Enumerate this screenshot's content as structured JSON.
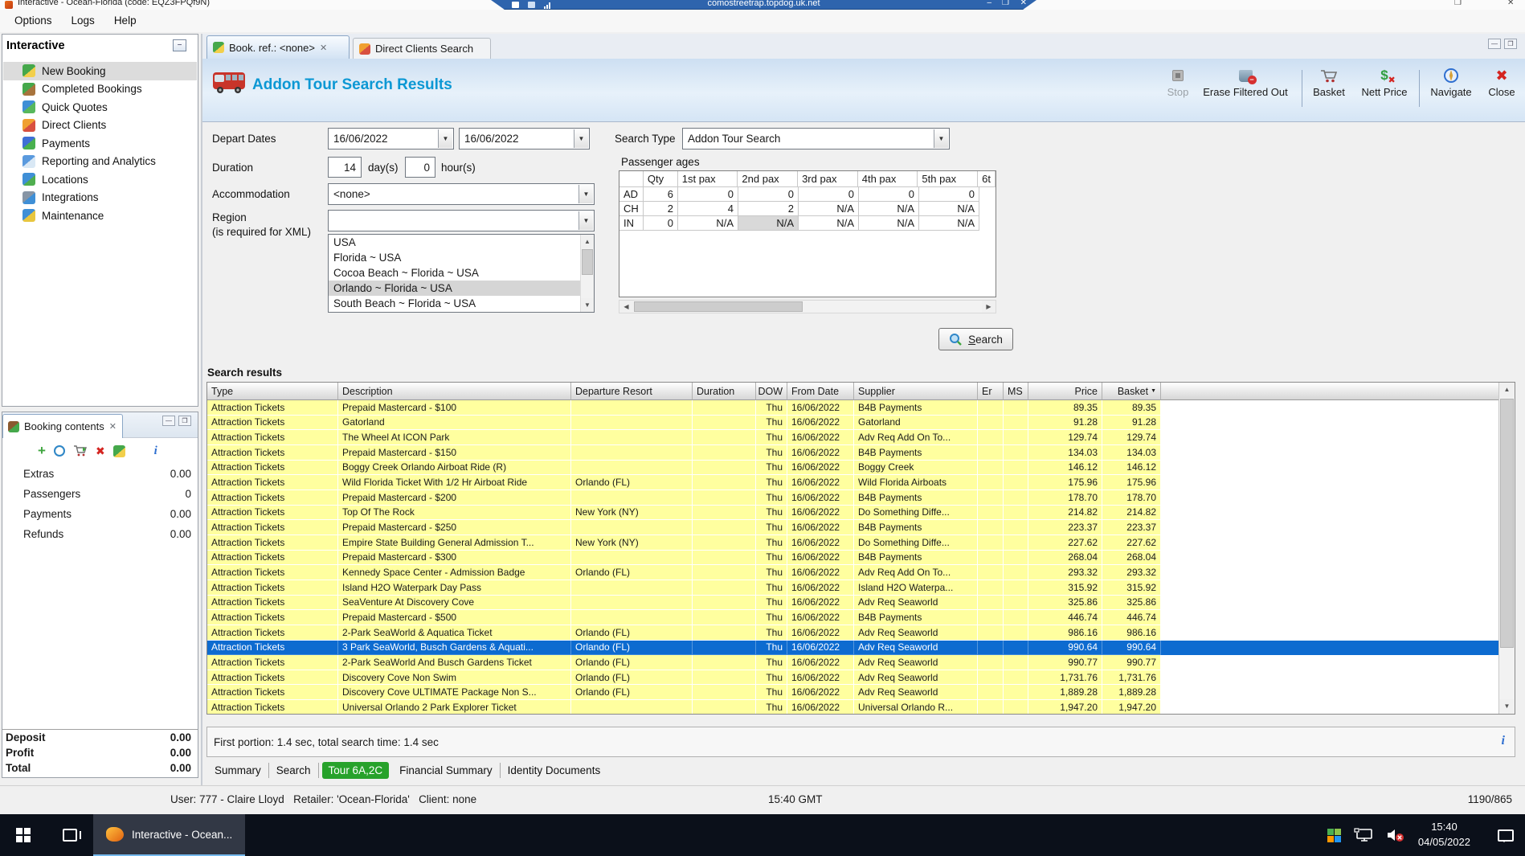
{
  "window": {
    "title": "Interactive - Ocean-Florida (code: EQZ3FPQf9N)",
    "menu": [
      "Options",
      "Logs",
      "Help"
    ],
    "rdp_address": "comostreetrap.topdog.uk.net"
  },
  "sidebar": {
    "title": "Interactive",
    "items": [
      {
        "label": "New Booking",
        "icon": "palm-tree-icon",
        "selected": true
      },
      {
        "label": "Completed Bookings",
        "icon": "completed-bookings-icon",
        "selected": false
      },
      {
        "label": "Quick Quotes",
        "icon": "quick-quotes-icon",
        "selected": false
      },
      {
        "label": "Direct Clients",
        "icon": "direct-clients-icon",
        "selected": false
      },
      {
        "label": "Payments",
        "icon": "payments-icon",
        "selected": false
      },
      {
        "label": "Reporting and Analytics",
        "icon": "reporting-icon",
        "selected": false
      },
      {
        "label": "Locations",
        "icon": "locations-icon",
        "selected": false
      },
      {
        "label": "Integrations",
        "icon": "integrations-icon",
        "selected": false
      },
      {
        "label": "Maintenance",
        "icon": "maintenance-icon",
        "selected": false
      }
    ]
  },
  "booking_contents": {
    "title": "Booking contents",
    "rows": [
      {
        "label": "Extras",
        "value": "0.00"
      },
      {
        "label": "Passengers",
        "value": "0"
      },
      {
        "label": "Payments",
        "value": "0.00"
      },
      {
        "label": "Refunds",
        "value": "0.00"
      }
    ],
    "totals": [
      {
        "label": "Deposit",
        "value": "0.00"
      },
      {
        "label": "Profit",
        "value": "0.00"
      },
      {
        "label": "Total",
        "value": "0.00"
      }
    ]
  },
  "tabs": {
    "book_ref": {
      "label": "Book. ref.: <none>"
    },
    "direct_clients": {
      "label": "Direct Clients Search"
    }
  },
  "header": {
    "title": "Addon Tour Search Results",
    "toolbar": [
      {
        "label": "Stop",
        "disabled": true
      },
      {
        "label": "Erase Filtered Out",
        "disabled": false
      },
      {
        "label": "Basket",
        "disabled": false
      },
      {
        "label": "Nett Price",
        "disabled": false
      },
      {
        "label": "Navigate",
        "disabled": false
      },
      {
        "label": "Close",
        "disabled": false
      }
    ]
  },
  "form": {
    "depart_dates": {
      "label": "Depart Dates",
      "from": "16/06/2022",
      "to": "16/06/2022"
    },
    "duration": {
      "label": "Duration",
      "days": "14",
      "days_unit": "day(s)",
      "hours": "0",
      "hours_unit": "hour(s)"
    },
    "accommodation": {
      "label": "Accommodation",
      "value": "<none>"
    },
    "region": {
      "label": "Region",
      "note": "(is required for XML)",
      "value": "",
      "options": [
        "USA",
        "Florida ~ USA",
        "Cocoa Beach ~ Florida ~ USA",
        "Orlando ~ Florida ~ USA",
        "South Beach ~ Florida ~ USA"
      ],
      "selected": "Orlando ~ Florida ~ USA"
    },
    "search_type": {
      "label": "Search Type",
      "value": "Addon Tour Search"
    },
    "search_button": "Search"
  },
  "passenger_ages": {
    "title": "Passenger ages",
    "columns": [
      "",
      "Qty",
      "1st pax",
      "2nd pax",
      "3rd pax",
      "4th pax",
      "5th pax",
      "6t"
    ],
    "rows": [
      {
        "label": "AD",
        "cells": [
          "6",
          "0",
          "0",
          "0",
          "0",
          "0"
        ]
      },
      {
        "label": "CH",
        "cells": [
          "2",
          "4",
          "2",
          "N/A",
          "N/A",
          "N/A"
        ]
      },
      {
        "label": "IN",
        "cells": [
          "0",
          "N/A",
          "N/A",
          "N/A",
          "N/A",
          "N/A"
        ]
      }
    ],
    "selected_cell": {
      "row": 2,
      "cell": 2
    }
  },
  "results": {
    "label": "Search results",
    "status": "First portion: 1.4 sec, total search time: 1.4 sec",
    "columns": [
      "Type",
      "Description",
      "Departure Resort",
      "Duration",
      "DOW",
      "From Date",
      "Supplier",
      "Er",
      "MS",
      "Price",
      "Basket"
    ],
    "sorted_column": "Basket",
    "selected_row": 16,
    "rows": [
      [
        "Attraction Tickets",
        "Prepaid Mastercard - $100",
        "",
        "",
        "Thu",
        "16/06/2022",
        "B4B Payments",
        "",
        "",
        "89.35",
        "89.35"
      ],
      [
        "Attraction Tickets",
        "Gatorland",
        "",
        "",
        "Thu",
        "16/06/2022",
        "Gatorland",
        "",
        "",
        "91.28",
        "91.28"
      ],
      [
        "Attraction Tickets",
        "The Wheel At ICON Park",
        "",
        "",
        "Thu",
        "16/06/2022",
        "Adv Req Add On To...",
        "",
        "",
        "129.74",
        "129.74"
      ],
      [
        "Attraction Tickets",
        "Prepaid Mastercard - $150",
        "",
        "",
        "Thu",
        "16/06/2022",
        "B4B Payments",
        "",
        "",
        "134.03",
        "134.03"
      ],
      [
        "Attraction Tickets",
        "Boggy Creek Orlando Airboat Ride (R)",
        "",
        "",
        "Thu",
        "16/06/2022",
        "Boggy Creek",
        "",
        "",
        "146.12",
        "146.12"
      ],
      [
        "Attraction Tickets",
        "Wild Florida Ticket With 1/2 Hr Airboat Ride",
        "Orlando (FL)",
        "",
        "Thu",
        "16/06/2022",
        "Wild Florida Airboats",
        "",
        "",
        "175.96",
        "175.96"
      ],
      [
        "Attraction Tickets",
        "Prepaid Mastercard - $200",
        "",
        "",
        "Thu",
        "16/06/2022",
        "B4B Payments",
        "",
        "",
        "178.70",
        "178.70"
      ],
      [
        "Attraction Tickets",
        "Top Of The Rock",
        "New York (NY)",
        "",
        "Thu",
        "16/06/2022",
        "Do Something Diffe...",
        "",
        "",
        "214.82",
        "214.82"
      ],
      [
        "Attraction Tickets",
        "Prepaid Mastercard - $250",
        "",
        "",
        "Thu",
        "16/06/2022",
        "B4B Payments",
        "",
        "",
        "223.37",
        "223.37"
      ],
      [
        "Attraction Tickets",
        "Empire State Building General Admission T...",
        "New York (NY)",
        "",
        "Thu",
        "16/06/2022",
        "Do Something Diffe...",
        "",
        "",
        "227.62",
        "227.62"
      ],
      [
        "Attraction Tickets",
        "Prepaid Mastercard - $300",
        "",
        "",
        "Thu",
        "16/06/2022",
        "B4B Payments",
        "",
        "",
        "268.04",
        "268.04"
      ],
      [
        "Attraction Tickets",
        "Kennedy Space Center - Admission Badge",
        "Orlando (FL)",
        "",
        "Thu",
        "16/06/2022",
        "Adv Req Add On To...",
        "",
        "",
        "293.32",
        "293.32"
      ],
      [
        "Attraction Tickets",
        "Island H2O Waterpark Day Pass",
        "",
        "",
        "Thu",
        "16/06/2022",
        "Island H2O Waterpa...",
        "",
        "",
        "315.92",
        "315.92"
      ],
      [
        "Attraction Tickets",
        "SeaVenture At Discovery Cove",
        "",
        "",
        "Thu",
        "16/06/2022",
        "Adv Req Seaworld",
        "",
        "",
        "325.86",
        "325.86"
      ],
      [
        "Attraction Tickets",
        "Prepaid Mastercard - $500",
        "",
        "",
        "Thu",
        "16/06/2022",
        "B4B Payments",
        "",
        "",
        "446.74",
        "446.74"
      ],
      [
        "Attraction Tickets",
        "2-Park SeaWorld & Aquatica Ticket",
        "Orlando (FL)",
        "",
        "Thu",
        "16/06/2022",
        "Adv Req Seaworld",
        "",
        "",
        "986.16",
        "986.16"
      ],
      [
        "Attraction Tickets",
        "3 Park SeaWorld, Busch Gardens & Aquati...",
        "Orlando (FL)",
        "",
        "Thu",
        "16/06/2022",
        "Adv Req Seaworld",
        "",
        "",
        "990.64",
        "990.64"
      ],
      [
        "Attraction Tickets",
        "2-Park SeaWorld And Busch Gardens Ticket",
        "Orlando (FL)",
        "",
        "Thu",
        "16/06/2022",
        "Adv Req Seaworld",
        "",
        "",
        "990.77",
        "990.77"
      ],
      [
        "Attraction Tickets",
        "Discovery Cove Non Swim",
        "Orlando (FL)",
        "",
        "Thu",
        "16/06/2022",
        "Adv Req Seaworld",
        "",
        "",
        "1,731.76",
        "1,731.76"
      ],
      [
        "Attraction Tickets",
        "Discovery Cove ULTIMATE Package Non S...",
        "Orlando (FL)",
        "",
        "Thu",
        "16/06/2022",
        "Adv Req Seaworld",
        "",
        "",
        "1,889.28",
        "1,889.28"
      ],
      [
        "Attraction Tickets",
        "Universal Orlando 2 Park Explorer Ticket",
        "",
        "",
        "Thu",
        "16/06/2022",
        "Universal Orlando R...",
        "",
        "",
        "1,947.20",
        "1,947.20"
      ]
    ]
  },
  "bottom_tabs": [
    {
      "label": "Summary",
      "active": false
    },
    {
      "label": "Search",
      "active": false
    },
    {
      "label": "Tour 6A,2C",
      "active": true
    },
    {
      "label": "Financial Summary",
      "active": false
    },
    {
      "label": "Identity Documents",
      "active": false
    }
  ],
  "status_bar": {
    "user": "User: 777 - Claire Lloyd",
    "retailer": "Retailer: 'Ocean-Florida'",
    "client": "Client: none",
    "time": "15:40 GMT",
    "resolution": "1190/865"
  },
  "taskbar": {
    "app_label": "Interactive - Ocean...",
    "time": "15:40",
    "date": "04/05/2022"
  },
  "colors": {
    "selection_blue": "#0d6bd0",
    "row_yellow": "#ffff9f",
    "active_tab_green": "#27a22b",
    "title_blue": "#0c98d4"
  }
}
